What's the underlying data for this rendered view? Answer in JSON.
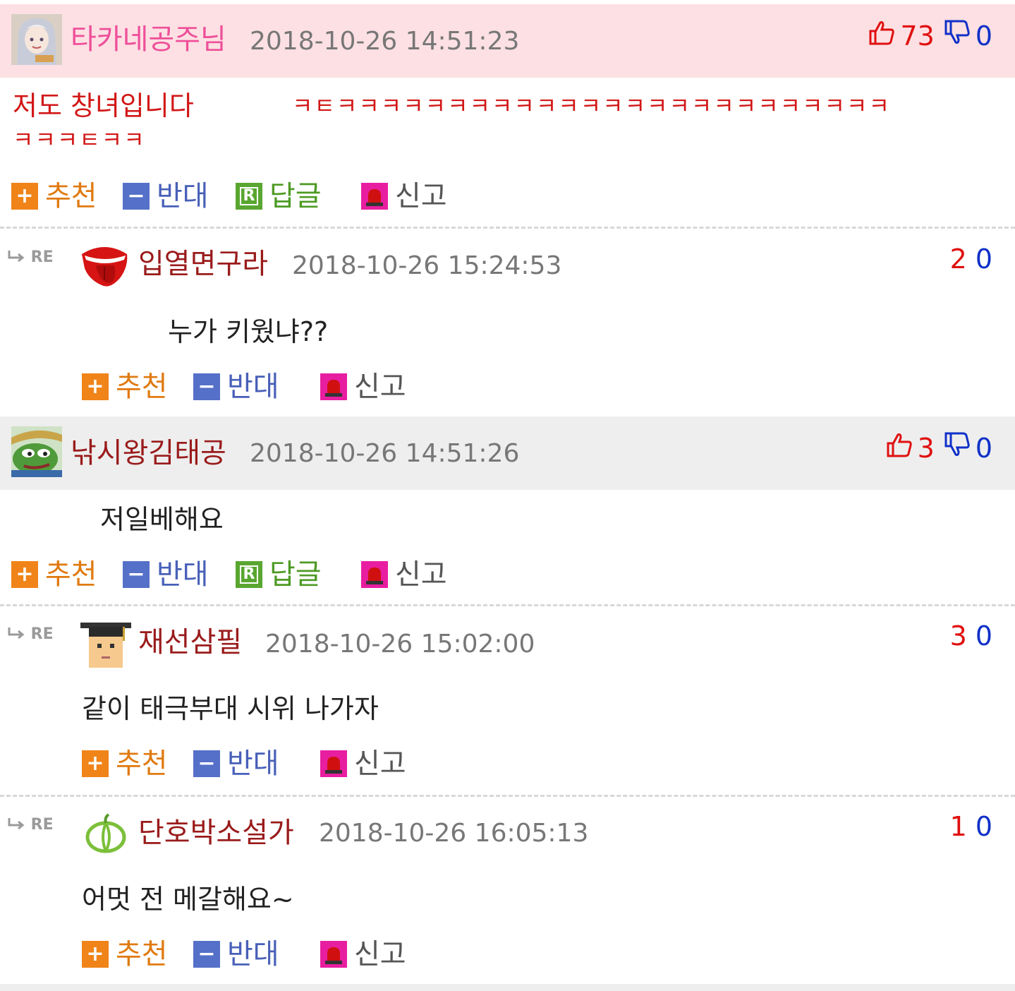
{
  "colors": {
    "header_main": "#fde0e3",
    "header_alt": "#eeeeee",
    "like_red": "#e01010",
    "dislike_blue": "#1030c8",
    "nick_pink": "#ee4f9a",
    "nick_dark": "#9a1b1b"
  },
  "icons": {
    "thumb_up": "thumbs-up-icon",
    "thumb_down": "thumbs-down-icon",
    "recommend": "plus-icon",
    "oppose": "minus-icon",
    "reply": "reply-r-icon",
    "report": "siren-icon",
    "reply_arrow": "reply-arrow-icon"
  },
  "action_labels": {
    "recommend": "추천",
    "oppose": "반대",
    "reply": "답글",
    "report": "신고"
  },
  "re_label": "RE",
  "comments": [
    {
      "nickname": "타카네공주님",
      "datetime": "2018-10-26 14:51:23",
      "likes": "73",
      "dislikes": "0",
      "body_line1_a": "저도 창녀입니다",
      "body_line1_b": "ㅋㅌㅋㅋㅋㅋㅋㅋㅋㅋㅋㅋㅋㅋㅋㅋㅋㅋㅋㅋㅋㅋㅋㅋㅋㅋㅋ",
      "body_line2": "ㅋㅋㅋㅌㅋㅋ"
    },
    {
      "nickname": "입열면구라",
      "datetime": "2018-10-26 15:24:53",
      "likes": "2",
      "dislikes": "0",
      "body": "누가 키웠냐??"
    },
    {
      "nickname": "낚시왕김태공",
      "datetime": "2018-10-26 14:51:26",
      "likes": "3",
      "dislikes": "0",
      "body": "저일베해요"
    },
    {
      "nickname": "재선삼필",
      "datetime": "2018-10-26 15:02:00",
      "likes": "3",
      "dislikes": "0",
      "body": "같이 태극부대 시위 나가자"
    },
    {
      "nickname": "단호박소설가",
      "datetime": "2018-10-26 16:05:13",
      "likes": "1",
      "dislikes": "0",
      "body": "어멋 전 메갈해요~"
    }
  ]
}
